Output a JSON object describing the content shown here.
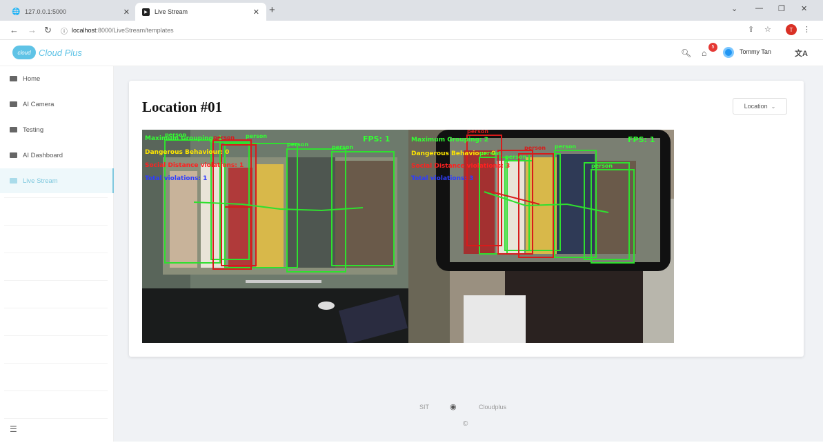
{
  "browser": {
    "tabs": [
      {
        "title": "127.0.0.1:5000",
        "icon": "globe-icon"
      },
      {
        "title": "Live Stream",
        "icon": "stream-icon"
      }
    ],
    "url_host": "localhost",
    "url_path": ":8000/LiveStream/templates",
    "profile_initial": "T"
  },
  "app": {
    "brand": "Cloud Plus",
    "logo_text": "cloud",
    "notification_count": "5",
    "user_name": "Tommy Tan"
  },
  "sidebar": {
    "items": [
      {
        "label": "Home"
      },
      {
        "label": "AI Camera"
      },
      {
        "label": "Testing"
      },
      {
        "label": "AI Dashboard"
      },
      {
        "label": "Live Stream"
      }
    ],
    "active_index": 4
  },
  "main": {
    "title": "Location #01",
    "location_button": "Location"
  },
  "feeds": [
    {
      "fps": "FPS: 1",
      "stats": [
        {
          "text": "Maximum Grouping: 1",
          "color": "#33ff33"
        },
        {
          "text": "Dangerous Behaviour: 0",
          "color": "#ffe600"
        },
        {
          "text": "Social Distance violations: 1",
          "color": "#ff2020"
        },
        {
          "text": "Total violations: 1",
          "color": "#2e3cff"
        }
      ],
      "person_labels": [
        "person",
        "person",
        "person",
        "person",
        "person"
      ]
    },
    {
      "fps": "FPS: 1",
      "stats": [
        {
          "text": "Maximum Grouping: 2",
          "color": "#33ff33"
        },
        {
          "text": "Dangerous Behaviour: 0",
          "color": "#ffe600"
        },
        {
          "text": "Social Distance violations: 3",
          "color": "#ff2020"
        },
        {
          "text": "Total violations: 3",
          "color": "#2e3cff"
        }
      ],
      "person_labels": [
        "person",
        "person",
        "person",
        "person",
        "person",
        "person"
      ]
    }
  ],
  "footer": {
    "left_link": "SIT",
    "right_link": "Cloudplus",
    "copyright": "©"
  }
}
